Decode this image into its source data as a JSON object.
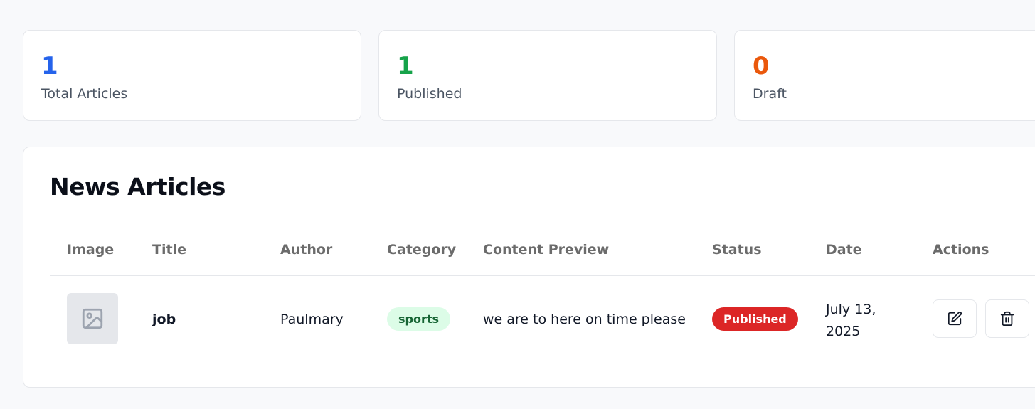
{
  "stats": [
    {
      "value": "1",
      "label": "Total Articles",
      "color": "#2563eb"
    },
    {
      "value": "1",
      "label": "Published",
      "color": "#16a34a"
    },
    {
      "value": "0",
      "label": "Draft",
      "color": "#ea580c"
    }
  ],
  "articles_panel": {
    "title": "News Articles",
    "columns": [
      "Image",
      "Title",
      "Author",
      "Category",
      "Content Preview",
      "Status",
      "Date",
      "Actions"
    ],
    "rows": [
      {
        "image_icon": "image-placeholder-icon",
        "title": "job",
        "author": "Paulmary",
        "category": "sports",
        "content_preview": "we are to here on time please",
        "status": "Published",
        "date": "July 13, 2025",
        "actions": [
          "edit-icon",
          "trash-icon"
        ]
      }
    ]
  },
  "colors": {
    "category_badge_bg": "#dcfce7",
    "category_badge_text": "#166534",
    "status_published_bg": "#dc2626"
  }
}
